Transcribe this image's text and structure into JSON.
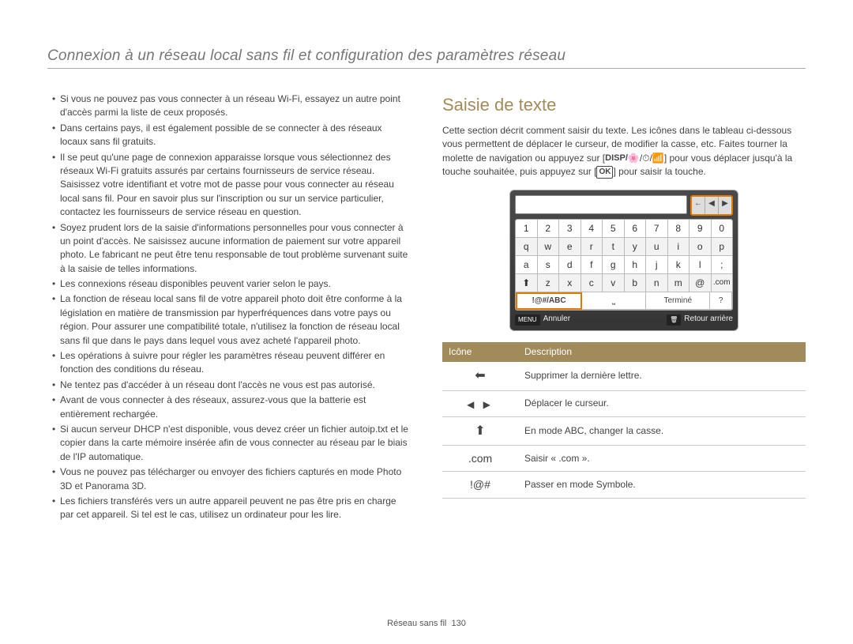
{
  "header": "Connexion à un réseau local sans fil et configuration des paramètres réseau",
  "left_bullets": [
    "Si vous ne pouvez pas vous connecter à un réseau Wi-Fi, essayez un autre point d'accès parmi la liste de ceux proposés.",
    "Dans certains pays, il est également possible de se connecter à des réseaux locaux sans fil gratuits.",
    "Il se peut qu'une page de connexion apparaisse lorsque vous sélectionnez des réseaux Wi-Fi gratuits assurés par certains fournisseurs de service réseau. Saisissez votre identifiant et votre mot de passe pour vous connecter au réseau local sans fil. Pour en savoir plus sur l'inscription ou sur un service particulier, contactez les fournisseurs de service réseau en question.",
    "Soyez prudent lors de la saisie d'informations personnelles pour vous connecter à un point d'accès. Ne saisissez aucune information de paiement sur votre appareil photo. Le fabricant ne peut être tenu responsable de tout problème survenant suite à la saisie de telles informations.",
    "Les connexions réseau disponibles peuvent varier selon le pays.",
    "La fonction de réseau local sans fil de votre appareil photo doit être conforme à la législation en matière de transmission par hyperfréquences dans votre pays ou région. Pour assurer une compatibilité totale, n'utilisez la fonction de réseau local sans fil que dans le pays dans lequel vous avez acheté l'appareil photo.",
    "Les opérations à suivre pour régler les paramètres réseau peuvent différer en fonction des conditions du réseau.",
    "Ne tentez pas d'accéder à un réseau dont l'accès ne vous est pas autorisé.",
    "Avant de vous connecter à des réseaux, assurez-vous que la batterie est entièrement rechargée.",
    "Si aucun serveur DHCP n'est disponible, vous devez créer un fichier autoip.txt et le copier dans la carte mémoire insérée afin de vous connecter au réseau par le biais de l'IP automatique.",
    "Vous ne pouvez pas télécharger ou envoyer des fichiers capturés en mode Photo 3D et Panorama 3D.",
    "Les fichiers transférés vers un autre appareil peuvent ne pas être pris en charge par cet appareil. Si tel est le cas, utilisez un ordinateur pour les lire."
  ],
  "right": {
    "heading": "Saisie de texte",
    "intro_pre": "Cette section décrit comment saisir du texte. Les icônes dans le tableau ci-dessous vous permettent de déplacer le curseur, de modifier la casse, etc. Faites tourner la molette de navigation ou appuyez sur [",
    "nav_label": "DISP/",
    "intro_mid": "] pour vous déplacer jusqu'à la touche souhaitée, puis appuyez sur [",
    "ok_label": "OK",
    "intro_post": "] pour saisir la touche."
  },
  "keyboard": {
    "arrow_back": "←",
    "arrow_left": "◀",
    "arrow_right": "▶",
    "row1": [
      "1",
      "2",
      "3",
      "4",
      "5",
      "6",
      "7",
      "8",
      "9",
      "0"
    ],
    "row2": [
      "q",
      "w",
      "e",
      "r",
      "t",
      "y",
      "u",
      "i",
      "o",
      "p"
    ],
    "row3": [
      "a",
      "s",
      "d",
      "f",
      "g",
      "h",
      "j",
      "k",
      "l",
      ";"
    ],
    "row4_shift": "⬆",
    "row4": [
      "z",
      "x",
      "c",
      "v",
      "b",
      "n",
      "m",
      "@",
      ".com"
    ],
    "bottom": {
      "mode": "!@#/ABC",
      "space": "⎵",
      "done": "Terminé",
      "help": "?"
    },
    "footer": {
      "menu_icon": "MENU",
      "cancel": "Annuler",
      "back_icon": "🗑",
      "back": "Retour arrière"
    }
  },
  "table": {
    "head_icon": "Icône",
    "head_desc": "Description",
    "rows": [
      {
        "icon_class": "arrow-left",
        "icon_text": "",
        "desc": "Supprimer la dernière lettre."
      },
      {
        "icon_class": "arrows-lr",
        "icon_text": "",
        "desc": "Déplacer le curseur."
      },
      {
        "icon_class": "arrow-up",
        "icon_text": "",
        "desc": "En mode ABC, changer la casse."
      },
      {
        "icon_class": "",
        "icon_text": ".com",
        "desc": "Saisir « .com »."
      },
      {
        "icon_class": "",
        "icon_text": "!@#",
        "desc": "Passer en mode Symbole."
      }
    ]
  },
  "footer": {
    "section": "Réseau sans fil",
    "page": "130"
  }
}
